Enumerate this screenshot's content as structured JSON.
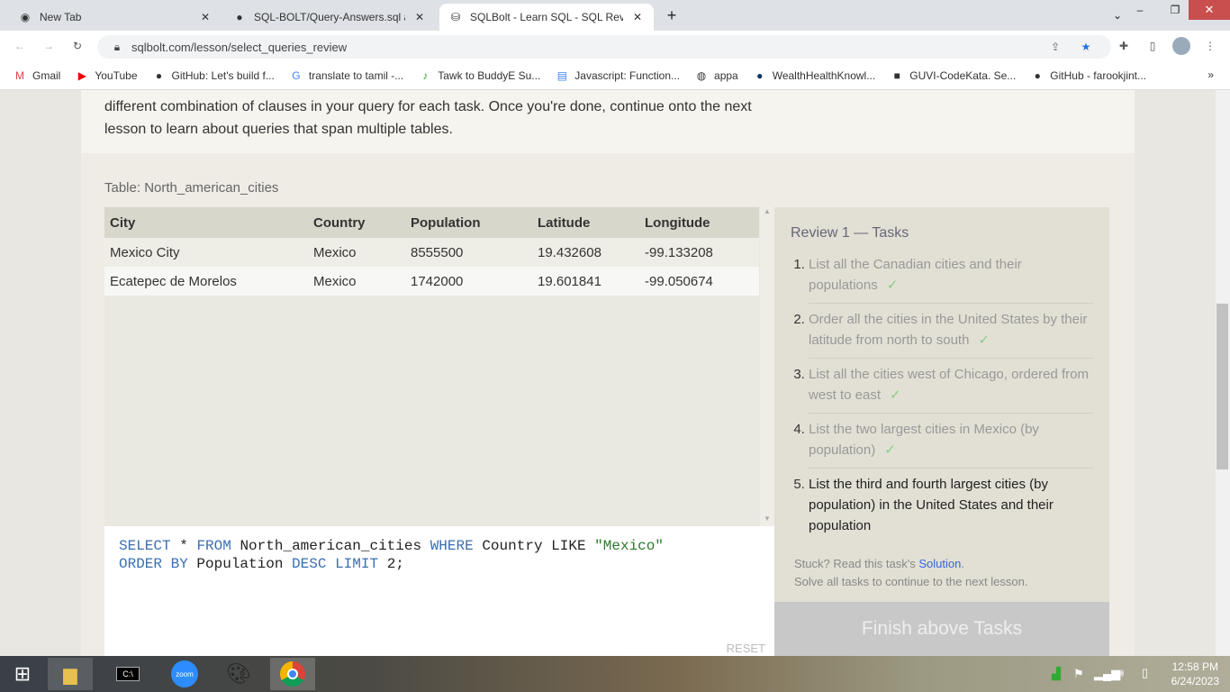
{
  "browser": {
    "tabs": [
      {
        "title": "New Tab",
        "icon": "chrome-icon"
      },
      {
        "title": "SQL-BOLT/Query-Answers.sql at",
        "icon": "github-icon"
      },
      {
        "title": "SQLBolt - Learn SQL - SQL Review",
        "icon": "database-icon",
        "active": true
      }
    ],
    "url": "sqlbolt.com/lesson/select_queries_review",
    "bookmarks": [
      "Gmail",
      "YouTube",
      "GitHub: Let's build f...",
      "translate to tamil -...",
      "Tawk to BuddyE Su...",
      "Javascript: Function...",
      "appa",
      "WealthHealthKnowl...",
      "GUVI-CodeKata. Se...",
      "GitHub - farookjint..."
    ]
  },
  "intro": {
    "line1": "different combination of clauses in your query for each task. Once you're done, continue onto the next",
    "line2": "lesson to learn about queries that span multiple tables."
  },
  "table": {
    "label": "Table: North_american_cities",
    "columns": [
      "City",
      "Country",
      "Population",
      "Latitude",
      "Longitude"
    ],
    "rows": [
      [
        "Mexico City",
        "Mexico",
        "8555500",
        "19.432608",
        "-99.133208"
      ],
      [
        "Ecatepec de Morelos",
        "Mexico",
        "1742000",
        "19.601841",
        "-99.050674"
      ]
    ]
  },
  "editor": {
    "line1": [
      "SELECT",
      "*",
      "FROM",
      "North_american_cities",
      "WHERE",
      "Country",
      "LIKE",
      "\"Mexico\""
    ],
    "line2": [
      "ORDER BY",
      "Population",
      "DESC",
      "LIMIT",
      "2;"
    ],
    "reset": "RESET"
  },
  "tasks": {
    "title": "Review 1 — Tasks",
    "check": "✓",
    "items": [
      "List all the Canadian cities and their populations",
      "Order all the cities in the United States by their latitude from north to south",
      "List all the cities west of Chicago, ordered from west to east",
      "List the two largest cities in Mexico (by population)",
      "List the third and fourth largest cities (by population) in the United States and their population"
    ],
    "stuck": "Stuck? Read this task's ",
    "solution": "Solution",
    "period": ".",
    "solve_all": "Solve all tasks to continue to the next lesson.",
    "finish": "Finish above Tasks"
  },
  "clock": {
    "time": "12:58 PM",
    "date": "6/24/2023"
  }
}
